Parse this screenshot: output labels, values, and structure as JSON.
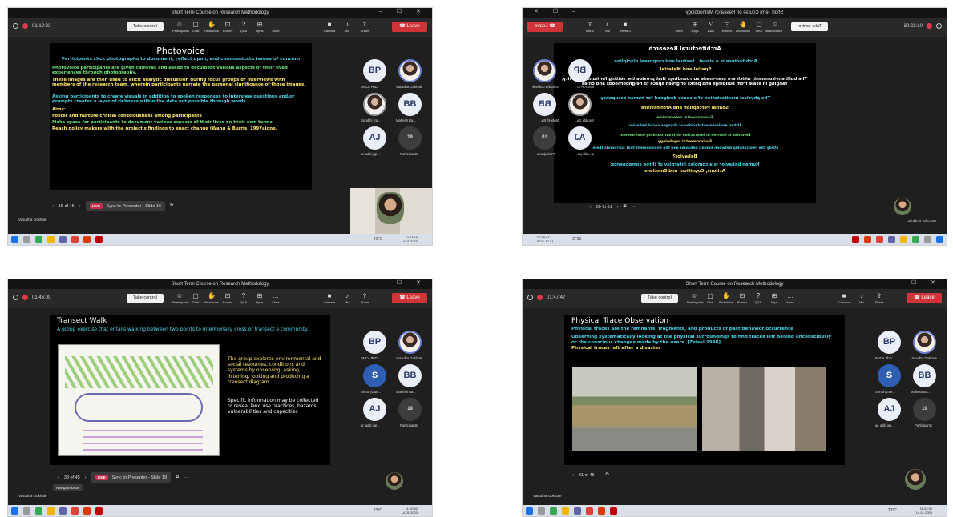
{
  "window": {
    "title": "Short Term Course on Research Methodology",
    "controls": "– ☐ ✕"
  },
  "toolbar": {
    "take_control": "Take control",
    "leave": "Leave",
    "tools": [
      "Participants",
      "Chat",
      "Reactions",
      "Rooms",
      "Q&A",
      "Apps",
      "More"
    ],
    "media": [
      "Camera",
      "Mic",
      "Share"
    ]
  },
  "tools_icons": [
    "people-icon",
    "chat-icon",
    "reactions-icon",
    "rooms-icon",
    "qa-icon",
    "apps-icon",
    "more-icon"
  ],
  "colors": {
    "leave": "#d13438",
    "slide_bg": "#000000",
    "yellow": "#ffe66d",
    "cyan": "#4fd2e8",
    "green": "#6de07a"
  },
  "presenter": "Vasudha Gokhale",
  "participants": {
    "count": "19",
    "label": "Participants",
    "list": [
      {
        "initials": "BP",
        "name": "BNCA PhD"
      },
      {
        "initials": "",
        "name": "Vasudha Gokhale"
      },
      {
        "initials": "BB",
        "name": "Mahesh Ba..."
      },
      {
        "initials": "AJ",
        "name": "ar. aditi jap..."
      }
    ]
  },
  "panels": [
    {
      "time": "01:12:33",
      "nav": "15 of 45",
      "sync": "Sync to Presenter - Slide 16",
      "clock": "10:47:16",
      "date": "14-01-2023",
      "weather": "21°C",
      "extra_name": "Surabhi Ga...",
      "slide": {
        "title": "Photovoice",
        "lines": [
          {
            "t": "Participants click photographs to document, reflect upon, and communicate issues of concern",
            "c": "tcy"
          },
          {
            "t": "Photovoice participants are given cameras and asked to document various aspects of their lived experiences through photography.",
            "c": "tgr"
          },
          {
            "t": "These images are then used to elicit analytic discussion during focus groups or interviews with members of the research team, wherein participants narrate the personal significance of those images.",
            "c": "tyl"
          },
          {
            "t": " Asking participants to create visuals in addition to spoken responses to interview questions and/or prompts creates a layer of richness within the data not possible through words",
            "c": "tcy"
          },
          {
            "t": "Aims:",
            "c": "tyl"
          },
          {
            "t": "Foster and nurture critical consciousness among participants",
            "c": "tyl"
          },
          {
            "t": "Make space for participants to document various aspects of their lives on their own terms",
            "c": "tgr"
          },
          {
            "t": "Reach policy makers with the project's findings to enact change (Wang & Burris, 1997alone.",
            "c": "tyl"
          }
        ]
      }
    },
    {
      "time": "01:22:06",
      "nav": "16 of 45",
      "sync": "",
      "clock": "10:57:27",
      "date": "14-01-2023",
      "weather": "22°C",
      "extra_name": "Surabhi Ga...",
      "slide": {
        "title": "Architectural Research",
        "lines": [
          {
            "t": "Architecture is a visual  ,  textual  and corporeal  discipline.",
            "c": "tcy"
          },
          {
            "t": "Spatial and Material.",
            "c": "tyl"
          },
          {
            "t": "The built environment, which are man-made surroundings that provide the setting for human activity,  ranging in scale from buildings and parks or green space to  neighborhoods and cities",
            "c": "twh"
          },
          {
            "t": "The physical manifestation of a space designed for human occupancy.",
            "c": "tcy"
          },
          {
            "t": "Spatial Perception and Architecture",
            "c": "tyl"
          },
          {
            "t": "Environmental determinism",
            "c": "tgr"
          },
          {
            "t": "Urban environment decides or changes social behavior",
            "c": "tcy"
          },
          {
            "t": "Behavior is learned in interaction with surrounding environment",
            "c": "tgr"
          },
          {
            "t": "Environmental psychology",
            "c": "tyl"
          },
          {
            "t": "Study the relationship between human behavior and the environment that surrounds them.",
            "c": "tcy"
          },
          {
            "t": "Behavior?",
            "c": "tyl"
          },
          {
            "t": "Human behavior is a complex interplay of three components:",
            "c": "tcy"
          },
          {
            "t": "Actions, Cognition, and Emotions",
            "c": "tyl"
          }
        ]
      }
    },
    {
      "time": "01:46:09",
      "nav": "38 of 45",
      "sync": "Sync to Presenter - Slide 19",
      "clock": "11:20:52",
      "date": "14-01-2023",
      "weather": "23°C",
      "extra_name": "Shruti (Gue...",
      "tooltip": "Navigate back",
      "slide": {
        "title": "Transect Walk",
        "lines": [
          {
            "t": "A group exercise that entails walking between two points to intentionally cross or transect a community.",
            "c": "tcy"
          },
          {
            "t": "The group explores environmental and social resources, conditions and systems by observing, asking, listening, looking and producing a transect diagram.",
            "c": "tyl"
          },
          {
            "t": "Specific information may be collected to reveal land use practices, hazards, vulnerabilities and capacities",
            "c": "twh"
          }
        ]
      }
    },
    {
      "time": "01:47:47",
      "nav": "31 of 45",
      "sync": "",
      "clock": "11:22:30",
      "date": "14-01-2023",
      "weather": "23°C",
      "extra_name": "Shruti (Gue...",
      "slide": {
        "title": "Physical Trace Observation",
        "lines": [
          {
            "t": "Physical traces are the remnants, fragments, and products of past behavior/occurrence",
            "c": "tcy"
          },
          {
            "t": "Observing systematically looking at the physical surroundings to find traces left behind unconsciously or the conscious changes made by the users. [Zeisel,1998]",
            "c": "tcy"
          },
          {
            "t": "Physical traces left after a disaster",
            "c": "tyl"
          }
        ]
      }
    }
  ]
}
